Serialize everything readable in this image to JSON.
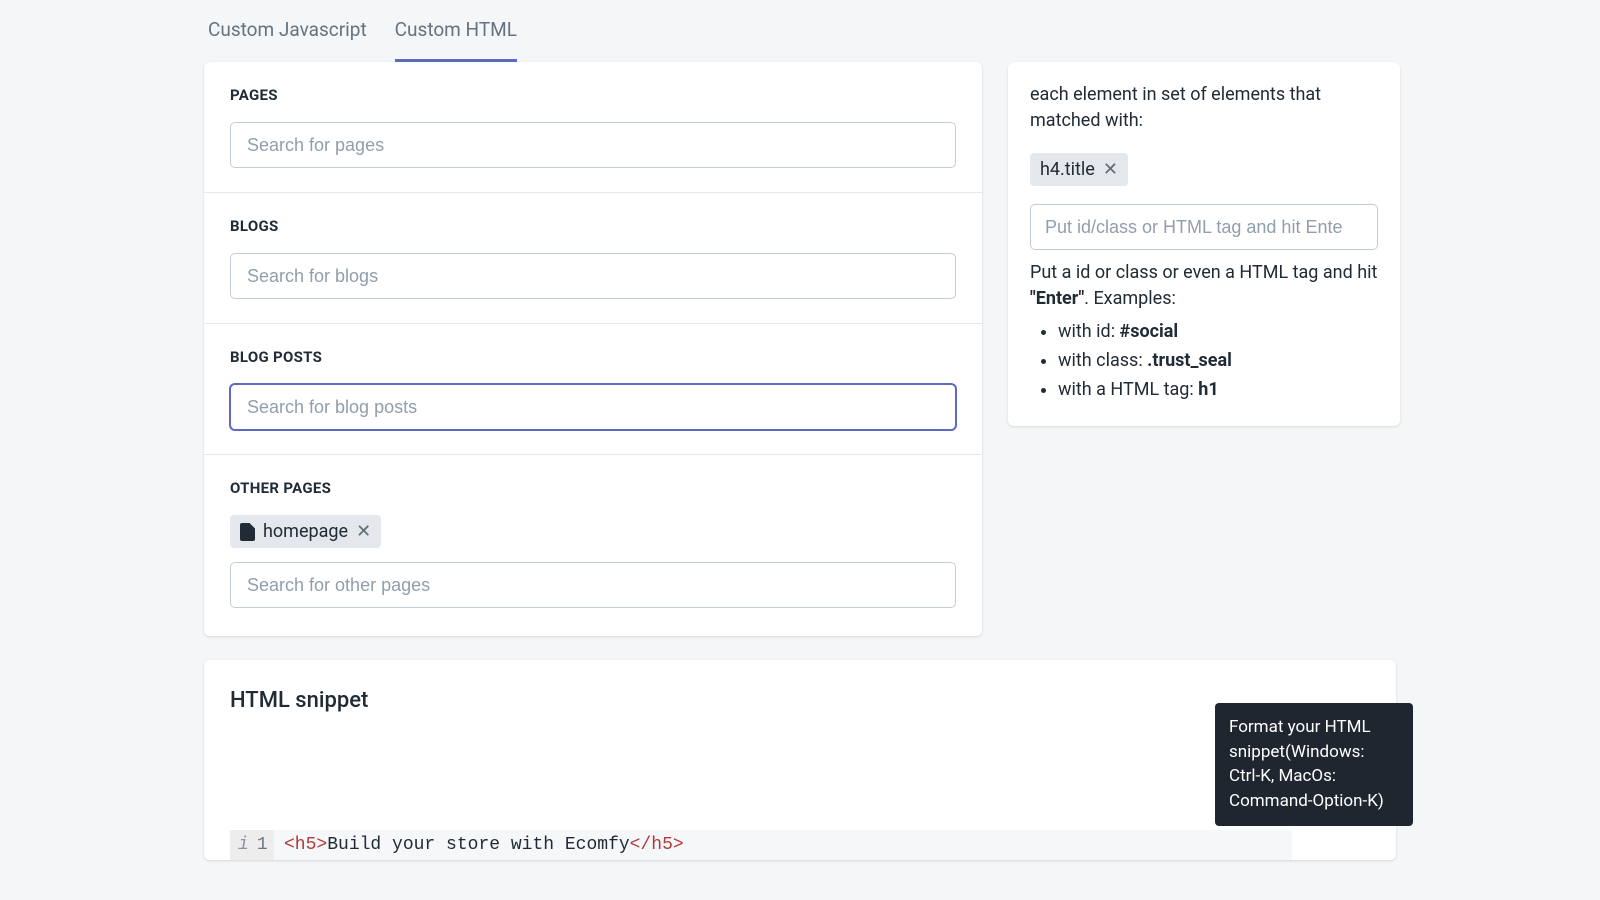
{
  "tabs": {
    "js": "Custom Javascript",
    "html": "Custom HTML"
  },
  "sections": {
    "pages": {
      "title": "PAGES",
      "placeholder": "Search for pages"
    },
    "blogs": {
      "title": "BLOGS",
      "placeholder": "Search for blogs"
    },
    "blog_posts": {
      "title": "BLOG POSTS",
      "placeholder": "Search for blog posts"
    },
    "other_pages": {
      "title": "OTHER PAGES",
      "chip": "homepage",
      "placeholder": "Search for other pages"
    }
  },
  "sidebar": {
    "intro": "each element in set of elements that matched with:",
    "chip": "h4.title",
    "input_placeholder": "Put id/class or HTML tag and hit Ente",
    "help_line": "Put a id or class or even a HTML tag and hit ",
    "help_bold": "\"Enter\"",
    "help_tail": ". Examples:",
    "ex1_pre": "with id: ",
    "ex1_b": "#social",
    "ex2_pre": "with class: ",
    "ex2_b": ".trust_seal",
    "ex3_pre": "with a HTML tag: ",
    "ex3_b": "h1"
  },
  "snippet": {
    "title": "HTML snippet",
    "format": "Format",
    "tooltip": "Format your HTML snippet(Windows: Ctrl-K, MacOs: Command-Option-K)",
    "line_no": "1",
    "code_open": "<h5>",
    "code_text": "Build your store with Ecomfy",
    "code_close": "</h5>"
  }
}
